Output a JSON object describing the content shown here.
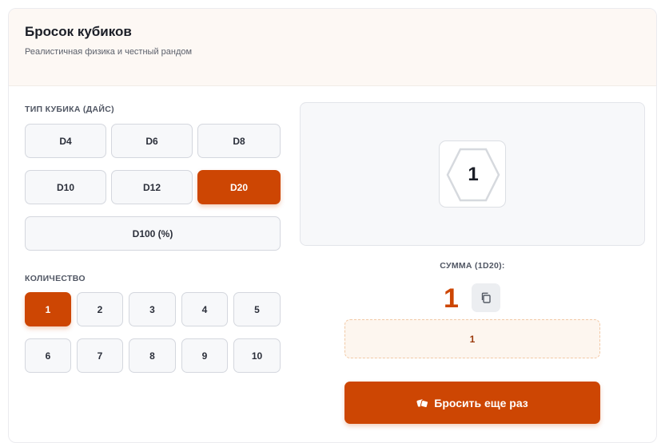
{
  "header": {
    "title": "Бросок кубиков",
    "subtitle": "Реалистичная физика и честный рандом"
  },
  "dice_type": {
    "label": "ТИП КУБИКА (ДАЙС)",
    "options": [
      "D4",
      "D6",
      "D8",
      "D10",
      "D12",
      "D20",
      "D100 (%)"
    ],
    "selected": "D20"
  },
  "quantity": {
    "label": "КОЛИЧЕСТВО",
    "options": [
      "1",
      "2",
      "3",
      "4",
      "5",
      "6",
      "7",
      "8",
      "9",
      "10"
    ],
    "selected": "1"
  },
  "result": {
    "die_value": "1",
    "sum_label": "СУММА (1D20):",
    "sum_value": "1",
    "rolls_text": "1",
    "roll_button_label": "Бросить еще раз"
  },
  "icons": {
    "die_shape": "hexagon-d20-icon",
    "copy": "copy-icon",
    "roll": "dice-icon"
  },
  "colors": {
    "accent": "#cd4603",
    "header_bg": "#fdf8f4"
  }
}
